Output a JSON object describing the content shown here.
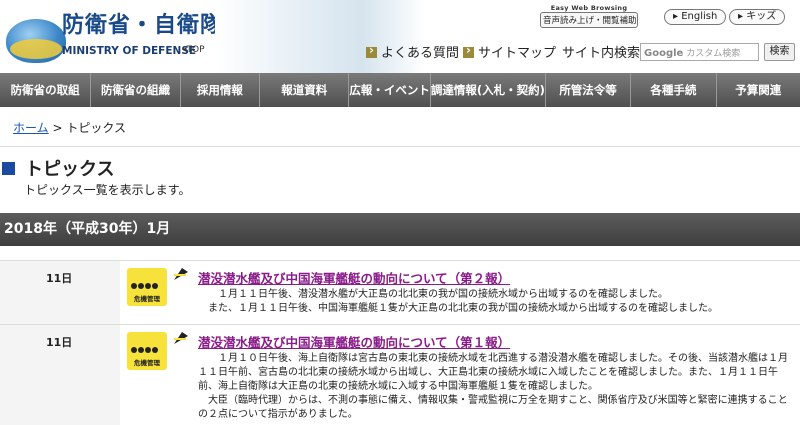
{
  "header": {
    "logo_ja": "防衛省・自衛隊",
    "logo_en": "MINISTRY OF DEFENSE",
    "logo_top": "◂TOP",
    "easy_web_caption": "Easy Web Browsing",
    "easy_web_button": "音声読み上げ・閲覧補助",
    "english_button": "English",
    "kids_button": "キッズ",
    "faq_link": "よくある質問",
    "sitemap_link": "サイトマップ",
    "search_label": "サイト内検索",
    "search_placeholder_brand": "Google",
    "search_placeholder": "カスタム検索",
    "search_button": "検索"
  },
  "nav": {
    "items": [
      "防衛省の取組",
      "防衛省の組織",
      "採用情報",
      "報道資料",
      "広報・イベント",
      "調達情報(入札・契約)",
      "所管法令等",
      "各種手続",
      "予算関連"
    ]
  },
  "breadcrumb": {
    "home": "ホーム",
    "sep": " > ",
    "current": "トピックス"
  },
  "page": {
    "title": "トピックス",
    "description": "トピックス一覧を表示します。",
    "month": "2018年（平成30年）1月"
  },
  "news": [
    {
      "date": "11日",
      "category": "危機管理",
      "title": "潜没潜水艦及び中国海軍艦艇の動向について（第２報）",
      "text": "　　１月１１日午後、潜没潜水艦が大正島の北北東の我が国の接続水域から出域するのを確認しました。\n　また、１月１１日午後、中国海軍艦艇１隻が大正島の北北東の我が国の接続水域から出域するのを確認しました。"
    },
    {
      "date": "11日",
      "category": "危機管理",
      "title": "潜没潜水艦及び中国海軍艦艇の動向について（第１報）",
      "text": "　　１月１０日午後、海上自衛隊は宮古島の東北東の接続水域を北西進する潜没潜水艦を確認しました。その後、当該潜水艦は１月１１日午前、宮古島の北北東の接続水域から出域し、大正島北東の接続水域に入域したことを確認しました。また、１月１１日午前、海上自衛隊は大正島の北東の接続水域に入域する中国海軍艦艇１隻を確認しました。\n　大臣（臨時代理）からは、不測の事態に備え、情報収集・警戒監視に万全を期すこと、関係省庁及び米国等と緊密に連携することの２点について指示がありました。"
    }
  ],
  "colors": {
    "nav_bg": "#5f5f5f",
    "title_mark": "#1c4aa0",
    "news_title": "#8a1b8a",
    "link": "#1b55b5",
    "category_badge": "#f6e23b"
  }
}
